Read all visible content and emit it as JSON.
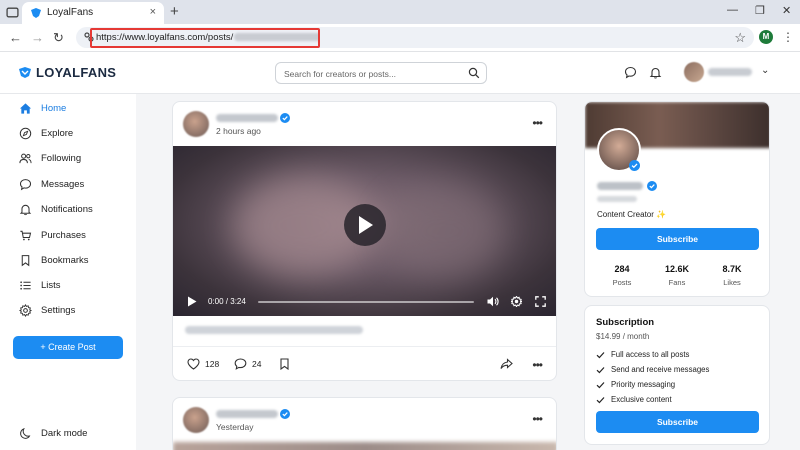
{
  "browser": {
    "tab_title": "LoyalFans",
    "tab_close": "×",
    "new_tab": "+",
    "url_visible": "https://www.loyalfans.com/posts/",
    "profile_initial": "M",
    "window_min": "—",
    "window_max": "❐",
    "window_close": "✕"
  },
  "header": {
    "logo_text": "LOYALFANS",
    "search_placeholder": "Search for creators or posts..."
  },
  "sidebar": {
    "items": [
      {
        "label": "Home",
        "icon": "home-icon",
        "active": true
      },
      {
        "label": "Explore",
        "icon": "compass-icon"
      },
      {
        "label": "Following",
        "icon": "users-icon"
      },
      {
        "label": "Messages",
        "icon": "chat-icon"
      },
      {
        "label": "Notifications",
        "icon": "bell-icon"
      },
      {
        "label": "Purchases",
        "icon": "cart-icon"
      },
      {
        "label": "Bookmarks",
        "icon": "bookmark-icon"
      },
      {
        "label": "Lists",
        "icon": "list-icon"
      },
      {
        "label": "Settings",
        "icon": "gear-icon"
      }
    ],
    "create_post": "+  Create Post",
    "dark_mode": "Dark mode"
  },
  "feed": {
    "posts": [
      {
        "time": "2 hours ago",
        "video_time": "0:00 / 3:24",
        "progress": 0,
        "likes": "128",
        "comments": "24"
      },
      {
        "time": "Yesterday"
      }
    ]
  },
  "profile": {
    "bio": "Content Creator ✨",
    "subscribe": "Subscribe",
    "stats": [
      {
        "value": "284",
        "label": "Posts"
      },
      {
        "value": "12.6K",
        "label": "Fans"
      },
      {
        "value": "8.7K",
        "label": "Likes"
      }
    ]
  },
  "subscription": {
    "title": "Subscription",
    "price": "$14.99 / month",
    "features": [
      "Full access to all posts",
      "Send and receive messages",
      "Priority messaging",
      "Exclusive content"
    ],
    "subscribe": "Subscribe"
  },
  "colors": {
    "accent": "#1c8cf2",
    "highlight_border": "#e53935"
  }
}
